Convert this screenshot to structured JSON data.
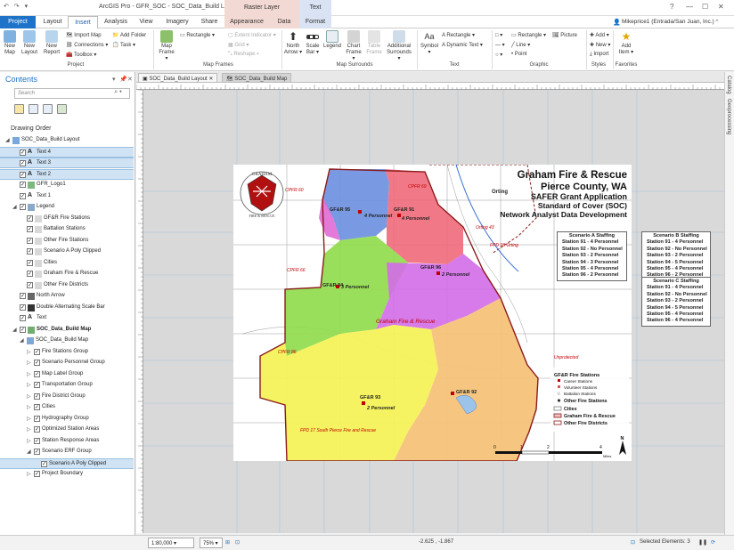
{
  "titlebar": {
    "qat": "↶ ↷ ▾",
    "title": "ArcGIS Pro - GFR_SOC - SOC_Data_Build Layout",
    "context_raster": "Raster Layer",
    "context_text": "Text"
  },
  "tabs": {
    "project": "Project",
    "layout": "Layout",
    "insert": "Insert",
    "analysis": "Analysis",
    "view": "View",
    "imagery": "Imagery",
    "share": "Share",
    "appearance": "Appearance",
    "data": "Data",
    "format": "Format",
    "user": "Mikeprice1 (Entrada/San Juan, Inc.)"
  },
  "ribbon": {
    "project_group": "Project",
    "new_map": "New Map",
    "new_layout": "New Layout",
    "new_report": "New Report",
    "import_map": "Import Map",
    "connections": "Connections",
    "toolbox": "Toolbox",
    "add_folder": "Add Folder",
    "task": "Task",
    "map_frame": "Map Frame",
    "rectangle": "Rectangle",
    "extent_indicator": "Extent Indicator",
    "grid": "Grid",
    "reshape": "Reshape",
    "map_frames_group": "Map Frames",
    "north_arrow": "North Arrow",
    "scale_bar": "Scale Bar",
    "legend": "Legend",
    "chart_frame": "Chart Frame",
    "table_frame": "Table Frame",
    "additional_surrounds": "Additional Surrounds",
    "map_surrounds_group": "Map Surrounds",
    "symbol": "Symbol",
    "text_rectangle": "Rectangle",
    "dynamic_text": "Dynamic Text",
    "text_group": "Text",
    "g_rectangle": "Rectangle",
    "line": "Line",
    "point": "Point",
    "picture": "Picture",
    "graphic_group": "Graphic",
    "add": "Add",
    "new": "New",
    "import": "Import",
    "styles_group": "Styles",
    "add_item": "Add Item",
    "favorites_group": "Favorites"
  },
  "contents": {
    "title": "Contents",
    "search_placeholder": "Search",
    "drawing_order": "Drawing Order",
    "items": [
      {
        "label": "SOC_Data_Build Layout",
        "level": 0,
        "expander": "◢",
        "check": false,
        "icon": "layout",
        "selected": false
      },
      {
        "label": "Text 4",
        "level": 1,
        "expander": "",
        "check": true,
        "icon": "text",
        "selected": true
      },
      {
        "label": "Text 3",
        "level": 1,
        "expander": "",
        "check": true,
        "icon": "text",
        "selected": true
      },
      {
        "label": "Text 2",
        "level": 1,
        "expander": "",
        "check": true,
        "icon": "text",
        "selected": true
      },
      {
        "label": "GFR_Logo1",
        "level": 1,
        "expander": "",
        "check": true,
        "icon": "picture",
        "selected": false
      },
      {
        "label": "Text 1",
        "level": 1,
        "expander": "",
        "check": true,
        "icon": "text",
        "selected": false
      },
      {
        "label": "Legend",
        "level": 1,
        "expander": "◢",
        "check": true,
        "icon": "legend",
        "selected": false
      },
      {
        "label": "GF&R Fire Stations",
        "level": 2,
        "expander": "",
        "check": true,
        "icon": "item",
        "selected": false
      },
      {
        "label": "Battalion Stations",
        "level": 2,
        "expander": "",
        "check": true,
        "icon": "item",
        "selected": false
      },
      {
        "label": "Other Fire Stations",
        "level": 2,
        "expander": "",
        "check": true,
        "icon": "item",
        "selected": false
      },
      {
        "label": "Scenario A Poly Clipped",
        "level": 2,
        "expander": "",
        "check": true,
        "icon": "item",
        "selected": false
      },
      {
        "label": "Cities",
        "level": 2,
        "expander": "",
        "check": true,
        "icon": "item",
        "selected": false
      },
      {
        "label": "Graham Fire & Rescue",
        "level": 2,
        "expander": "",
        "check": true,
        "icon": "item",
        "selected": false
      },
      {
        "label": "Other Fire Districts",
        "level": 2,
        "expander": "",
        "check": true,
        "icon": "item",
        "selected": false
      },
      {
        "label": "North Arrow",
        "level": 1,
        "expander": "",
        "check": true,
        "icon": "north",
        "selected": false
      },
      {
        "label": "Double Alternating Scale Bar",
        "level": 1,
        "expander": "",
        "check": true,
        "icon": "scalebar",
        "selected": false
      },
      {
        "label": "Text",
        "level": 1,
        "expander": "",
        "check": true,
        "icon": "text",
        "selected": false
      },
      {
        "label": "SOC_Data_Build Map",
        "level": 1,
        "expander": "◢",
        "check": true,
        "icon": "mapframe",
        "selected": false,
        "bold": true
      },
      {
        "label": "SOC_Data_Build Map",
        "level": 2,
        "expander": "◢",
        "check": false,
        "icon": "map",
        "selected": false
      },
      {
        "label": "Fire Stations Group",
        "level": 3,
        "expander": "▷",
        "check": true,
        "icon": "",
        "selected": false
      },
      {
        "label": "Scenario Personnel Group",
        "level": 3,
        "expander": "▷",
        "check": true,
        "icon": "",
        "selected": false
      },
      {
        "label": "Map Label Group",
        "level": 3,
        "expander": "▷",
        "check": true,
        "icon": "",
        "selected": false
      },
      {
        "label": "Transportation Group",
        "level": 3,
        "expander": "▷",
        "check": true,
        "icon": "",
        "selected": false
      },
      {
        "label": "Fire District Group",
        "level": 3,
        "expander": "▷",
        "check": true,
        "icon": "",
        "selected": false
      },
      {
        "label": "Cities",
        "level": 3,
        "expander": "▷",
        "check": true,
        "icon": "",
        "selected": false
      },
      {
        "label": "Hydrography Group",
        "level": 3,
        "expander": "▷",
        "check": true,
        "icon": "",
        "selected": false
      },
      {
        "label": "Optimized Station Areas",
        "level": 3,
        "expander": "▷",
        "check": true,
        "icon": "",
        "selected": false
      },
      {
        "label": "Station Response Areas",
        "level": 3,
        "expander": "▷",
        "check": true,
        "icon": "",
        "selected": false
      },
      {
        "label": "Scenario ERF Group",
        "level": 3,
        "expander": "◢",
        "check": true,
        "icon": "",
        "selected": false
      },
      {
        "label": "Scenario A Poly Clipped",
        "level": 4,
        "expander": "",
        "check": true,
        "icon": "",
        "selected": true
      },
      {
        "label": "Project Boundary",
        "level": 3,
        "expander": "▷",
        "check": true,
        "icon": "",
        "selected": false
      }
    ]
  },
  "doc_tabs": [
    {
      "label": "SOC_Data_Build Layout",
      "active": true
    },
    {
      "label": "SOC_Data_Build Map",
      "active": false
    }
  ],
  "side_strip": [
    "Catalog",
    "Geoprocessing"
  ],
  "map": {
    "title1": "Graham Fire & Rescue",
    "title2": "Pierce County, WA",
    "title3": "SAFER Grant Application",
    "title4": "Standard of Cover (SOC)",
    "title5": "Network Analyst Data Development",
    "logo_top": "GRAHAM",
    "logo_bottom": "FIRE & RESCUE",
    "labels": {
      "s95": "GF&R 95",
      "s95p": "4 Personnel",
      "s91": "GF&R 91",
      "s91p": "4 Personnel",
      "s94": "GF&R 94",
      "s94p": "3 Personnel",
      "s96": "GF&R 96",
      "s96p": "2 Personnel",
      "s93": "GF&R 93",
      "s93p": "2 Personnel",
      "s92": "GF&R 92",
      "district": "Graham Fire & Rescue",
      "unprotected": "Unprotected",
      "fpd17": "FPD 17 South Pierce Fire and Rescue",
      "fpd18": "FPD 18 Orting",
      "orting": "Orting",
      "orting43": "Orting 43",
      "cpfr60": "CPFR 60",
      "cpfr66": "CPFR 66",
      "cpfr69": "CPFR 69",
      "cpfr86": "CPFR 86"
    },
    "legend": {
      "title": "GF&R Fire Stations",
      "career": "Career Stations",
      "volunteer": "Volunteer Stations",
      "battalion": "Battalion Stations",
      "other_fire": "Other Fire Stations",
      "cities": "Cities",
      "gfr": "Graham Fire & Rescue",
      "other_districts": "Other Fire Districts"
    },
    "scale": {
      "t0": "0",
      "t1": "1",
      "t2": "2",
      "t4": "4",
      "unit": "Miles"
    },
    "north": "N"
  },
  "scenario_a": {
    "title": "Scenario A Staffing",
    "rows": [
      "Station 91 - 4 Personnel",
      "Station 92 - No Personnel",
      "Station 93 - 2 Personnel",
      "Station 94 - 3 Personnel",
      "Station 95 - 4 Personnel",
      "Station 96 - 2 Personnel"
    ]
  },
  "scenario_b": {
    "title": "Scenario B Staffing",
    "rows": [
      "Station 91 - 4 Personnel",
      "Station 92 - No Personnel",
      "Station 93 - 2 Personnel",
      "Station 94 - 5 Personnel",
      "Station 95 - 4 Personnel",
      "Station 96 - 2 Personnel"
    ]
  },
  "scenario_c": {
    "title": "Scenario C Staffing",
    "rows": [
      "Station 91 - 4 Personnel",
      "Station 92 - No Personnel",
      "Station 93 - 2 Personnel",
      "Station 94 - 5 Personnel",
      "Station 95 - 4 Personnel",
      "Station 96 - 4 Personnel"
    ]
  },
  "statusbar": {
    "scale": "1:80,000",
    "zoom": "75%",
    "coords": "-2.625 , -1.867",
    "selected": "Selected Elements: 3"
  },
  "colors": {
    "accent": "#1e73c8",
    "selection": "#cfe3f5",
    "district_border": "#8b1a1a",
    "zone_blue": "#6a8fe0",
    "zone_red": "#f06a7a",
    "zone_green": "#8fdc4a",
    "zone_magenta": "#d36be8",
    "zone_yellow": "#f6f25a",
    "zone_orange": "#f5c37a"
  }
}
